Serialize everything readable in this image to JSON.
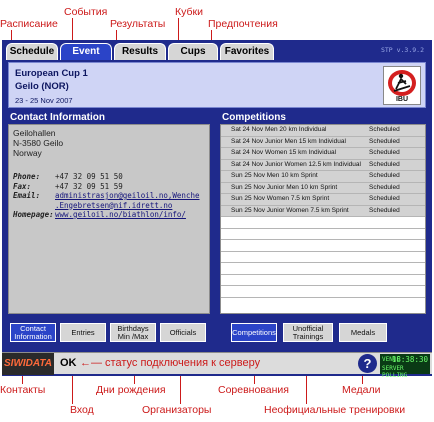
{
  "annotations": {
    "top": {
      "schedule": "Расписание",
      "events": "События",
      "results": "Результаты",
      "cups": "Кубки",
      "preferences": "Предпочтения"
    },
    "bottom": {
      "contacts": "Контакты",
      "login": "Вход",
      "birthdays": "Дни рождения",
      "organizers": "Организаторы",
      "competitions": "Соревнования",
      "medals": "Медали",
      "unofficial": "Неофициальные тренировки"
    },
    "status_note": "←— статус подключения к серверу"
  },
  "tabs": [
    {
      "label": "Schedule",
      "active": false
    },
    {
      "label": "Event",
      "active": true
    },
    {
      "label": "Results",
      "active": false
    },
    {
      "label": "Cups",
      "active": false
    },
    {
      "label": "Favorites",
      "active": false
    }
  ],
  "version": "STP v.3.9.2",
  "event": {
    "title": "European Cup 1",
    "location": "Geilo (NOR)",
    "dates": "23 - 25 Nov 2007",
    "logo_text": "IBU"
  },
  "contact": {
    "title": "Contact Information",
    "address": [
      "Geilohallen",
      "N-3580 Geilo",
      "Norway"
    ],
    "phone_label": "Phone:",
    "phone": "+47 32 09 51 50",
    "fax_label": "Fax:",
    "fax": "+47 32 09 51 59",
    "email_label": "Email:",
    "email": "administrasjon@geiloil.no,Wenche",
    "email_cont": ".Engebretsen@nif.idrett.no",
    "homepage_label": "Homepage:",
    "homepage": "www.geiloil.no/biathlon/info/"
  },
  "competitions": {
    "title": "Competitions",
    "rows": [
      {
        "name": "Sat 24 Nov Men 20 km Individual",
        "status": "Scheduled"
      },
      {
        "name": "Sat 24 Nov Junior Men 15 km Individual",
        "status": "Scheduled"
      },
      {
        "name": "Sat 24 Nov Women 15 km Individual",
        "status": "Scheduled"
      },
      {
        "name": "Sat 24 Nov Junior Women 12.5 km Individual",
        "status": "Scheduled"
      },
      {
        "name": "Sun 25 Nov Men 10 km Sprint",
        "status": "Scheduled"
      },
      {
        "name": "Sun 25 Nov Junior Men 10 km Sprint",
        "status": "Scheduled"
      },
      {
        "name": "Sun 25 Nov Women 7.5 km Sprint",
        "status": "Scheduled"
      },
      {
        "name": "Sun 25 Nov Junior Women 7.5 km Sprint",
        "status": "Scheduled"
      }
    ],
    "empty_rows": 7
  },
  "buttons": {
    "contact": "Contact Information",
    "entries": "Entries",
    "birthdays": "Birthdays Min /Max",
    "officials": "Officials",
    "competitions": "Competitions",
    "unofficial": "Unofficial Trainings",
    "medals": "Medals"
  },
  "status": {
    "brand": "SIWIDATA",
    "connection": "OK",
    "venue": "VENUE",
    "time": "18:38:30",
    "server": "SERVER POLLING"
  },
  "colors": {
    "app_bg": "#1f2a8c",
    "active_tab": "#2b44c8",
    "annotation": "#cc1a1a"
  }
}
